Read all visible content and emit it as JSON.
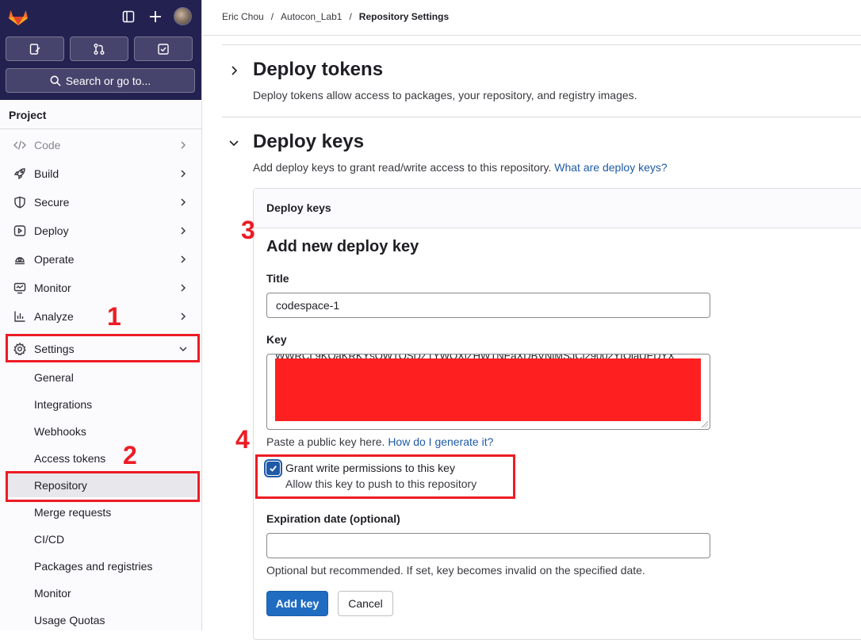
{
  "sidebar": {
    "search_label": "Search or go to...",
    "section_label": "Project",
    "nav": [
      {
        "label": "Code",
        "icon": "code-icon",
        "faded": true
      },
      {
        "label": "Build",
        "icon": "rocket-icon"
      },
      {
        "label": "Secure",
        "icon": "shield-icon"
      },
      {
        "label": "Deploy",
        "icon": "deploy-icon"
      },
      {
        "label": "Operate",
        "icon": "operate-icon"
      },
      {
        "label": "Monitor",
        "icon": "monitor-icon"
      },
      {
        "label": "Analyze",
        "icon": "chart-icon"
      },
      {
        "label": "Settings",
        "icon": "gear-icon",
        "expanded": true
      }
    ],
    "settings_items": [
      {
        "label": "General"
      },
      {
        "label": "Integrations"
      },
      {
        "label": "Webhooks"
      },
      {
        "label": "Access tokens"
      },
      {
        "label": "Repository",
        "active": true
      },
      {
        "label": "Merge requests"
      },
      {
        "label": "CI/CD"
      },
      {
        "label": "Packages and registries"
      },
      {
        "label": "Monitor"
      },
      {
        "label": "Usage Quotas"
      }
    ]
  },
  "breadcrumb": [
    "Eric Chou",
    "Autocon_Lab1",
    "Repository Settings"
  ],
  "sections": {
    "deploy_tokens": {
      "title": "Deploy tokens",
      "description": "Deploy tokens allow access to packages, your repository, and registry images."
    },
    "deploy_keys": {
      "title": "Deploy keys",
      "description": "Add deploy keys to grant read/write access to this repository.",
      "link": "What are deploy keys?"
    }
  },
  "card": {
    "header": "Deploy keys",
    "form_title": "Add new deploy key",
    "title_label": "Title",
    "title_value": "codespace-1",
    "key_label": "Key",
    "key_partial": "WWRCL9KOaKRKYsOWTOSDZ1YWOXlZHWTNEaXDBVNlMSJCl29002YtOlaUEDYX",
    "key_help": "Paste a public key here.",
    "key_help_link": "How do I generate it?",
    "checkbox_label": "Grant write permissions to this key",
    "checkbox_help": "Allow this key to push to this repository",
    "checkbox_checked": true,
    "expiration_label": "Expiration date (optional)",
    "expiration_value": "",
    "expiration_help": "Optional but recommended. If set, key becomes invalid on the specified date.",
    "submit_label": "Add key",
    "cancel_label": "Cancel"
  },
  "annotations": [
    "1",
    "2",
    "3",
    "4"
  ],
  "colors": {
    "sidebar_top": "#232150",
    "primary": "#1f6cc1",
    "link": "#1f5aa6",
    "annotation": "#ec1c24",
    "redaction": "#fe2020"
  }
}
